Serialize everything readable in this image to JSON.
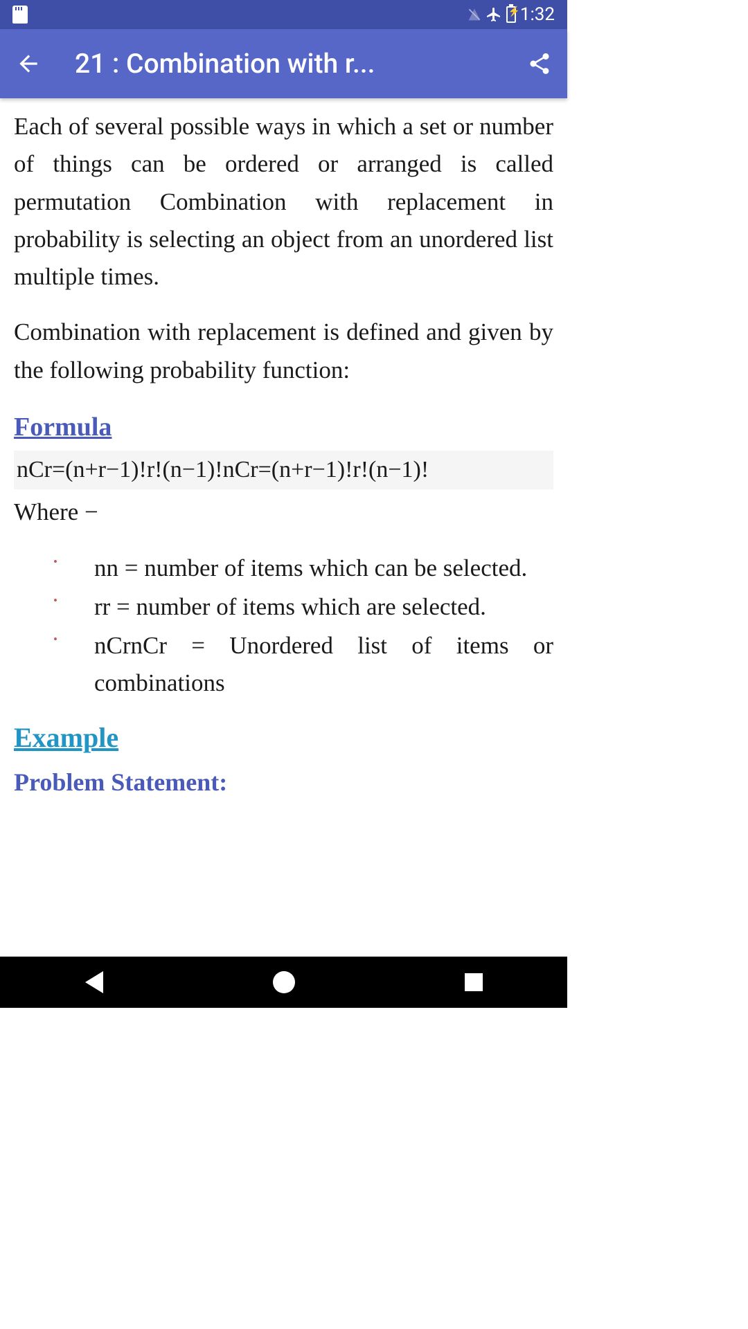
{
  "status_bar": {
    "time": "1:32"
  },
  "app_bar": {
    "title": "21 : Combination with r..."
  },
  "content": {
    "para1": "Each of several possible ways in which a set or number of things can be ordered or arranged is called permutation Combination with replacement in probability is selecting an object from an unordered list multiple times.",
    "para2": "Combination with replacement is defined and given by the following probability function:",
    "formula_heading": "Formula",
    "formula": "nCr=(n+r−1)!r!(n−1)!nCr=(n+r−1)!r!(n−1)!",
    "where_text": "Where −",
    "bullets": [
      "nn = number of items which can be selected.",
      "rr = number of items which are selected.",
      "nCrnCr = Unordered list of items or combinations"
    ],
    "example_heading": "Example",
    "problem_heading": "Problem Statement:"
  }
}
